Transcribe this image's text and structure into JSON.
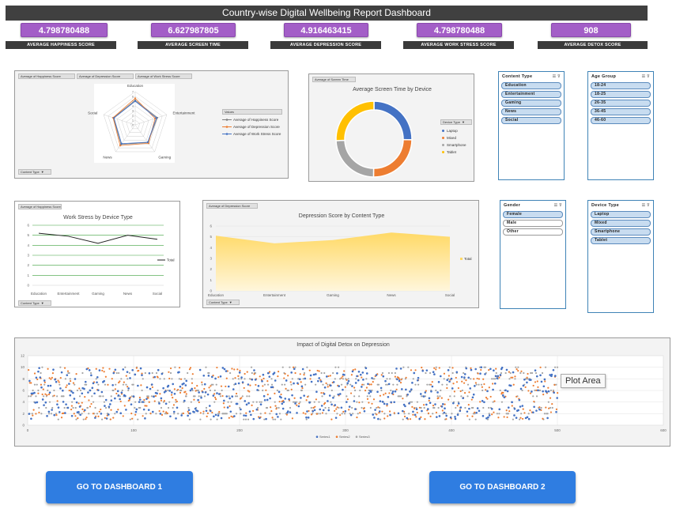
{
  "title": "Country-wise Digital Wellbeing Report Dashboard",
  "kpis": [
    {
      "value": "4.798780488",
      "label": "AVERAGE HAPPINESS SCORE"
    },
    {
      "value": "6.627987805",
      "label": "AVERAGE SCREEN TIME"
    },
    {
      "value": "4.916463415",
      "label": "AVERAGE DEPRESSION SCORE"
    },
    {
      "value": "4.798780488",
      "label": "AVERAGE WORK STRESS SCORE"
    },
    {
      "value": "908",
      "label": "AVERAGE DETOX SCORE"
    }
  ],
  "radar": {
    "buttons": [
      "Average of Happiness Score",
      "Average of Depression Score",
      "Average of Work Stress Score"
    ],
    "filter": "Content Type",
    "legend_title": "Values",
    "legend": [
      "Average of Happiness Score",
      "Average of Depression Score",
      "Average of Work Stress Score"
    ],
    "axes": [
      "Education",
      "Entertainment",
      "Gaming",
      "News",
      "Social"
    ],
    "ticks": [
      "0",
      "1",
      "2",
      "3",
      "4",
      "5",
      "6",
      "7"
    ]
  },
  "donut": {
    "button": "Average of Screen Time",
    "title": "Average Screen Time by Device",
    "filter": "Device Type",
    "legend": [
      "Laptop",
      "Mixed",
      "Smartphone",
      "Tablet"
    ]
  },
  "line": {
    "button": "Average of Happiness Score",
    "title": "Work Stress by Device Type",
    "filter": "Content Type",
    "legend": "Total",
    "yticks": [
      "6",
      "5",
      "4",
      "3",
      "2",
      "1",
      "0"
    ]
  },
  "area": {
    "button": "Average of Depression Score",
    "title": "Depression Score by Content Type",
    "filter": "Content Type",
    "legend": "Total",
    "yticks": [
      "6",
      "5",
      "4",
      "3",
      "2",
      "1",
      "0"
    ]
  },
  "scatter": {
    "title": "Impact of Digital Detox on Depression",
    "tooltip": "Plot Area",
    "legend": [
      "Series1",
      "Series2",
      "Series3"
    ],
    "yticks": [
      "12",
      "10",
      "8",
      "6",
      "4",
      "2",
      "0"
    ],
    "xticks": [
      "0",
      "100",
      "200",
      "300",
      "400",
      "500",
      "600"
    ]
  },
  "slicers": {
    "content_type": {
      "title": "Content Type",
      "items": [
        "Education",
        "Entertainment",
        "Gaming",
        "News",
        "Social"
      ]
    },
    "age_group": {
      "title": "Age Group",
      "items": [
        "18-24",
        "18-25",
        "26-35",
        "36-45",
        "46-60"
      ]
    },
    "gender": {
      "title": "Gender",
      "items": [
        "Female",
        "Male",
        "Other"
      ]
    },
    "device_type": {
      "title": "Device Type",
      "items": [
        "Laptop",
        "Mixed",
        "Smartphone",
        "Tablet"
      ]
    }
  },
  "nav": {
    "dashboard1": "GO TO DASHBOARD 1",
    "dashboard2": "GO TO DASHBOARD 2"
  },
  "chart_data": [
    {
      "type": "radar",
      "categories": [
        "Education",
        "Entertainment",
        "Gaming",
        "News",
        "Social"
      ],
      "ylim": [
        0,
        7
      ],
      "legend_placement": "right",
      "series": [
        {
          "name": "Average of Happiness Score",
          "color": "#7f7f7f",
          "values": [
            5.2,
            4.9,
            4.6,
            5.1,
            4.8
          ]
        },
        {
          "name": "Average of Depression Score",
          "color": "#ed7d31",
          "values": [
            5.6,
            4.4,
            4.8,
            5.4,
            4.9
          ]
        },
        {
          "name": "Average of Work Stress Score",
          "color": "#4472c4",
          "values": [
            5.0,
            4.7,
            4.5,
            4.9,
            4.7
          ]
        }
      ]
    },
    {
      "type": "pie",
      "title": "Average Screen Time by Device",
      "categories": [
        "Laptop",
        "Mixed",
        "Smartphone",
        "Tablet"
      ],
      "values": [
        6.7,
        6.6,
        6.4,
        6.8
      ],
      "colors": [
        "#4472c4",
        "#ed7d31",
        "#a5a5a5",
        "#ffc000"
      ]
    },
    {
      "type": "line",
      "title": "Work Stress by Device Type",
      "categories": [
        "Education",
        "Entertainment",
        "Gaming",
        "News",
        "Social"
      ],
      "ylim": [
        0,
        6
      ],
      "series": [
        {
          "name": "Total",
          "values": [
            5.2,
            4.9,
            4.2,
            5.0,
            4.6
          ]
        }
      ]
    },
    {
      "type": "area",
      "title": "Depression Score by Content Type",
      "categories": [
        "Education",
        "Entertainment",
        "Gaming",
        "News",
        "Social"
      ],
      "ylim": [
        0,
        6
      ],
      "series": [
        {
          "name": "Total",
          "values": [
            5.1,
            4.4,
            4.7,
            5.4,
            5.0
          ]
        }
      ]
    },
    {
      "type": "scatter",
      "title": "Impact of Digital Detox on Depression",
      "xlim": [
        0,
        600
      ],
      "ylim": [
        0,
        12
      ],
      "series": [
        {
          "name": "Series1",
          "color": "#4472c4",
          "count": 500,
          "y_range": [
            1,
            10
          ]
        },
        {
          "name": "Series2",
          "color": "#ed7d31",
          "count": 500,
          "y_range": [
            1,
            10
          ]
        },
        {
          "name": "Series3",
          "color": "#a5a5a5",
          "count": 500,
          "y_range": [
            1,
            10
          ]
        }
      ]
    }
  ]
}
